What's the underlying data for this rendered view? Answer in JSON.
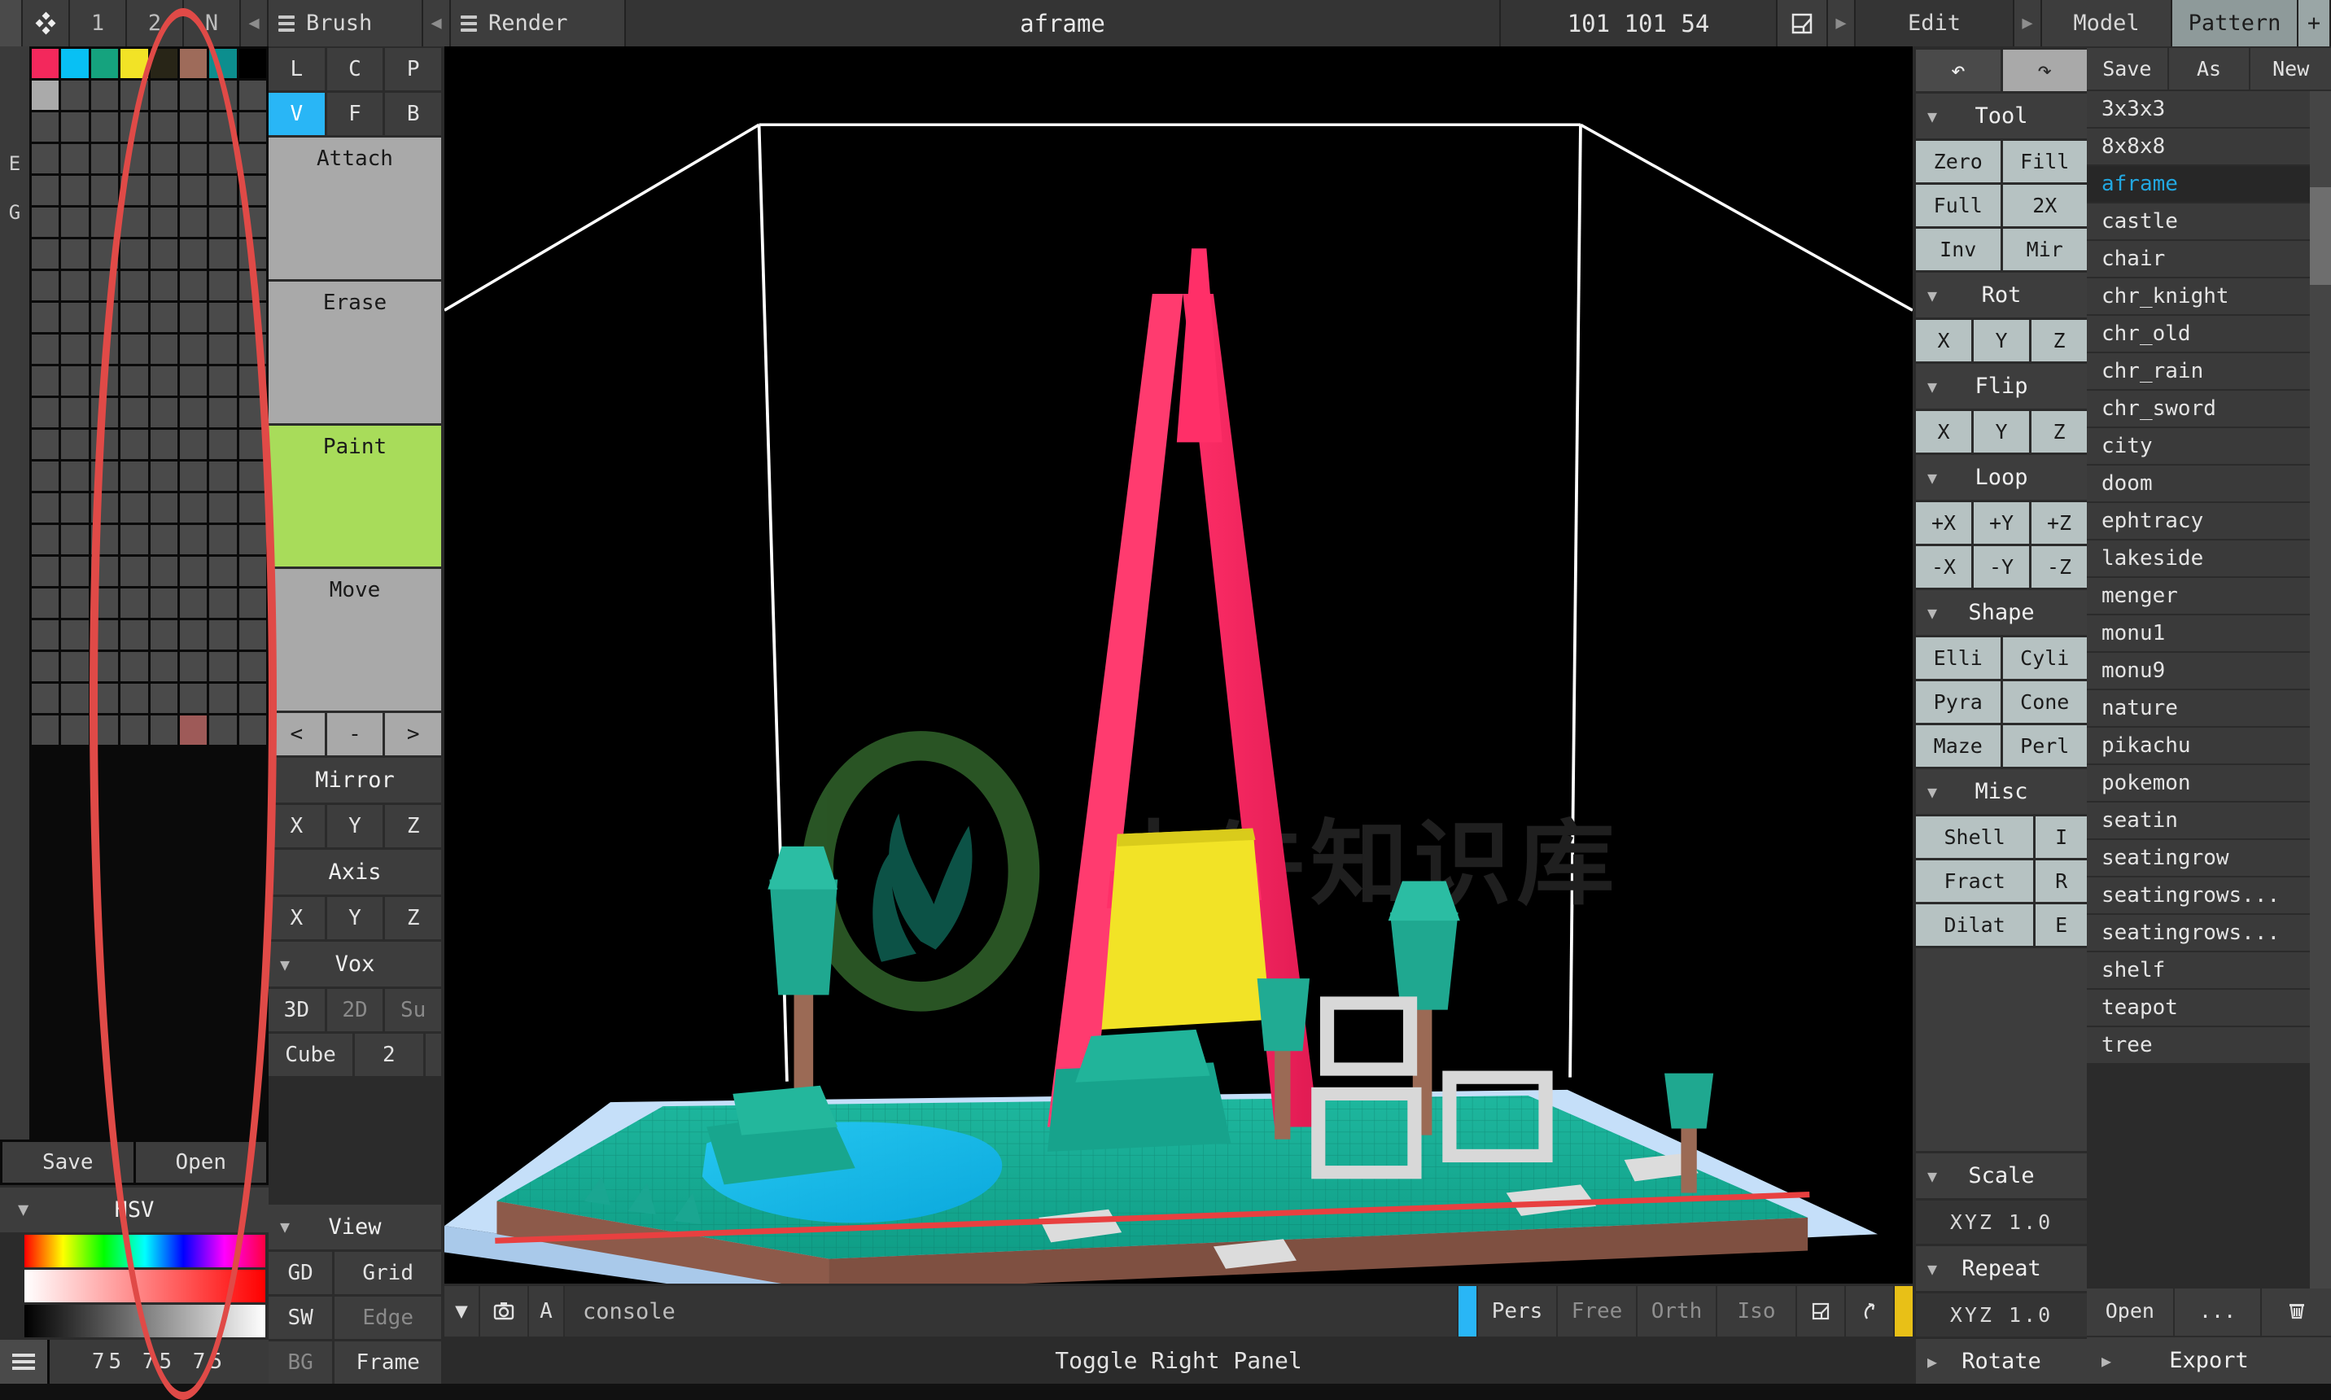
{
  "app": {
    "title": "aframe",
    "dimensions": "101 101 54",
    "icon": "voxel-diamond-icon",
    "tabs": [
      "1",
      "2",
      "N"
    ],
    "brush_menu": "Brush",
    "render_menu": "Render",
    "edit_menu": "Edit",
    "model_tab": "Model",
    "pattern_tab": "Pattern",
    "plus": "+",
    "box_icon": "bounding-box-icon",
    "left_arrow": "◀",
    "right_arrow": "▶"
  },
  "palette": {
    "side_labels": [
      "E",
      "G"
    ],
    "colors": [
      "#f3285c",
      "#08c0f4",
      "#15a37e",
      "#f2e326",
      "#282517",
      "#9e6b5a",
      "#0c8e8e",
      "#000000",
      "#aaaaaa",
      null,
      null,
      null,
      null,
      null,
      null,
      null
    ],
    "rows": 22,
    "cols": 8,
    "empty_color": "#4a4a4a",
    "selected_index": 181,
    "extra_swatch_index": 173,
    "extra_swatch_color": "#9e5a58",
    "save_label": "Save",
    "open_label": "Open",
    "hsv_label": "HSV",
    "rgb_values": "75 75 75",
    "menu_icon": "hamburger-icon"
  },
  "brush": {
    "row1": [
      "L",
      "C",
      "P"
    ],
    "row2": [
      "V",
      "F",
      "B"
    ],
    "row2_active": "V",
    "attach": "Attach",
    "erase": "Erase",
    "paint": "Paint",
    "move": "Move",
    "nav": [
      "<",
      "-",
      ">"
    ],
    "mirror_label": "Mirror",
    "mirror_axes": [
      "X",
      "Y",
      "Z"
    ],
    "axis_label": "Axis",
    "axis_axes": [
      "X",
      "Y",
      "Z"
    ],
    "vox_label": "Vox",
    "vox_modes": [
      "3D",
      "2D",
      "Su"
    ],
    "vox_modes_active": "3D",
    "cube_label": "Cube",
    "cube_size": "2",
    "view_label": "View",
    "view_rows": [
      {
        "key": "GD",
        "label": "Grid",
        "dim": false
      },
      {
        "key": "SW",
        "label": "Edge",
        "dim": true
      },
      {
        "key": "BG",
        "label": "Frame",
        "dim": false
      }
    ]
  },
  "edit": {
    "undo_icon": "undo-arrow-icon",
    "redo_icon": "redo-arrow-icon",
    "tool_label": "Tool",
    "tool_buttons": [
      "Zero",
      "Fill",
      "Full",
      "2X",
      "Inv",
      "Mir"
    ],
    "rot_label": "Rot",
    "rot_axes": [
      "X",
      "Y",
      "Z"
    ],
    "flip_label": "Flip",
    "flip_axes": [
      "X",
      "Y",
      "Z"
    ],
    "loop_label": "Loop",
    "loop_pos": [
      "+X",
      "+Y",
      "+Z"
    ],
    "loop_neg": [
      "-X",
      "-Y",
      "-Z"
    ],
    "shape_label": "Shape",
    "shape_buttons": [
      "Elli",
      "Cyli",
      "Pyra",
      "Cone",
      "Maze",
      "Perl"
    ],
    "misc_label": "Misc",
    "misc_rows": [
      {
        "label": "Shell",
        "key": "I"
      },
      {
        "label": "Fract",
        "key": "R"
      },
      {
        "label": "Dilat",
        "key": "E"
      }
    ],
    "scale_label": "Scale",
    "scale_value": "XYZ 1.0",
    "repeat_label": "Repeat",
    "repeat_value": "XYZ 1.0",
    "rotate_label": "Rotate"
  },
  "model": {
    "save": "Save",
    "as": "As",
    "new": "New",
    "items": [
      "3x3x3",
      "8x8x8",
      "aframe",
      "castle",
      "chair",
      "chr_knight",
      "chr_old",
      "chr_rain",
      "chr_sword",
      "city",
      "doom",
      "ephtracy",
      "lakeside",
      "menger",
      "monu1",
      "monu9",
      "nature",
      "pikachu",
      "pokemon",
      "seatin",
      "seatingrow",
      "seatingrows...",
      "seatingrows...",
      "shelf",
      "teapot",
      "tree"
    ],
    "selected": "aframe",
    "open": "Open",
    "more": "...",
    "trash_icon": "trash-icon",
    "export": "Export"
  },
  "viewport": {
    "caret_icon": "chevron-down-icon",
    "camera_icon": "camera-icon",
    "letter_a": "A",
    "console_text": "console",
    "modes": [
      {
        "label": "Pers",
        "active": true
      },
      {
        "label": "Free",
        "active": false
      },
      {
        "label": "Orth",
        "active": false
      },
      {
        "label": "Iso",
        "active": false
      }
    ],
    "axis_icon": "axis-box-icon",
    "orbit_icon": "orbit-icon",
    "toggle_right_panel": "Toggle Right Panel",
    "watermark": "小牛知识库"
  },
  "colors": {
    "accent_blue": "#29b6f6",
    "paint_green": "#a8dc5a",
    "selected_model": "#22a7e0",
    "annotation_red": "#e04a47",
    "yellow": "#e8c017"
  }
}
